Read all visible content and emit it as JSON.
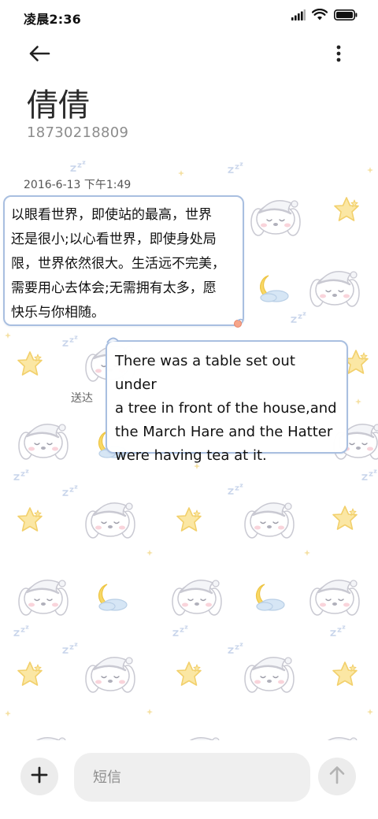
{
  "status_bar": {
    "time": "凌晨2:36",
    "icons": [
      "signal-icon",
      "wifi-icon",
      "battery-icon"
    ]
  },
  "header": {
    "back_icon": "arrow-left-icon",
    "more_icon": "more-vertical-icon",
    "contact_name": "倩倩",
    "contact_number": "18730218809"
  },
  "conversation": {
    "timestamp": "2016-6-13 下午1:49",
    "messages": [
      {
        "direction": "incoming",
        "lines": [
          "以眼看世界，即使站的最高，世界",
          "还是很小;以心看世界，即使身处局",
          "限，世界依然很大。生活远不完美，",
          "需要用心去体会;无需拥有太多，愿",
          "快乐与你相随。"
        ]
      },
      {
        "direction": "outgoing",
        "status": "送达",
        "lines": [
          "There was a table set out under",
          "a tree in front of the house,and",
          "the March Hare and the Hatter",
          "were having tea at it."
        ]
      }
    ]
  },
  "input_bar": {
    "add_icon": "plus-icon",
    "placeholder": "短信",
    "send_icon": "arrow-up-icon"
  },
  "colors": {
    "bubble_border": "#a9bfe0",
    "input_background": "#efefef",
    "button_background": "#ececec",
    "accent_star": "#f7d774",
    "accent_moon": "#f5cf5a",
    "accent_cloud": "#c7dbef"
  }
}
